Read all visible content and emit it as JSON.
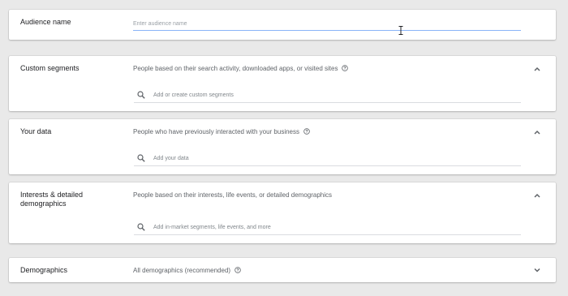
{
  "audience_name": {
    "label": "Audience name",
    "placeholder": "Enter audience name"
  },
  "sections": {
    "custom_segments": {
      "label": "Custom segments",
      "description": "People based on their search activity, downloaded apps, or visited sites",
      "search_placeholder": "Add or create custom segments",
      "expanded": true
    },
    "your_data": {
      "label": "Your data",
      "description": "People who have previously interacted with your business",
      "search_placeholder": "Add your data",
      "expanded": true
    },
    "interests": {
      "label": "Interests & detailed demographics",
      "description": "People based on their interests, life events, or detailed demographics",
      "search_placeholder": "Add in-market segments, life events, and more",
      "expanded": true
    },
    "demographics": {
      "label": "Demographics",
      "description": "All demographics (recommended)",
      "expanded": false
    }
  },
  "icons": {
    "help": "help-circle-icon",
    "search": "search-icon",
    "expand_less": "chevron-up-icon",
    "expand_more": "chevron-down-icon"
  },
  "colors": {
    "page_bg": "#e9e9e9",
    "card_bg": "#ffffff",
    "focus_underline": "#8ab4f8",
    "text_primary": "#202124",
    "text_secondary": "#5f6368"
  }
}
